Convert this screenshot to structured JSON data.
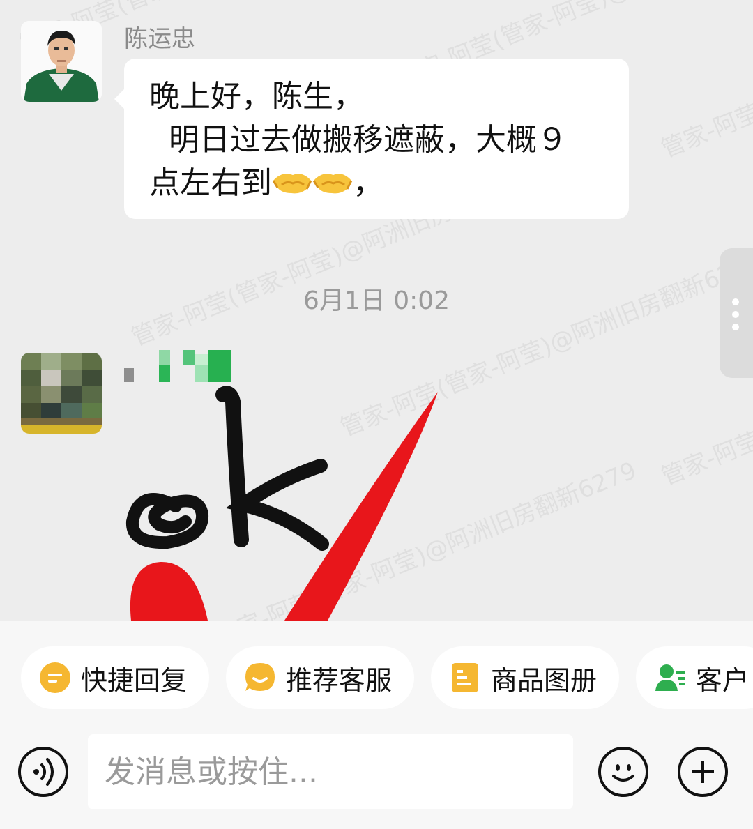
{
  "watermark": "管家-阿莹(管家-阿莹)@阿洲旧房翻新6279",
  "messages": [
    {
      "sender": "陈运忠",
      "lines": [
        "晚上好，陈生，",
        "  明日过去做搬移遮蔽，大概９",
        "点左右到",
        "，"
      ],
      "emoji": "handshake-emoji"
    }
  ],
  "timestamp": "6月1日  0:02",
  "quick_actions": [
    {
      "label": "快捷回复",
      "icon": "quick-reply-icon",
      "color": "#f5b731"
    },
    {
      "label": "推荐客服",
      "icon": "recommend-service-icon",
      "color": "#f5b731"
    },
    {
      "label": "商品图册",
      "icon": "product-album-icon",
      "color": "#f5b731"
    },
    {
      "label": "客户",
      "icon": "customer-icon",
      "color": "#2eae4f"
    }
  ],
  "composer": {
    "placeholder": "发消息或按住...",
    "voice_icon": "voice-icon",
    "emoji_icon": "emoji-icon",
    "plus_icon": "plus-icon"
  }
}
